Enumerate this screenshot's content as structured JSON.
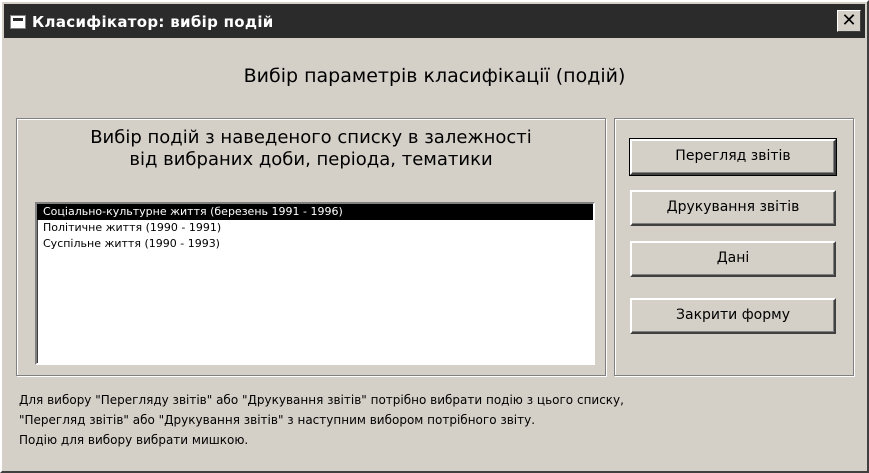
{
  "window": {
    "title": "Класифікатор: вибір подій",
    "close_glyph": "✕"
  },
  "heading": "Вибір параметрів класифікації (подій)",
  "left_panel": {
    "title_line1": "Вибір подій з наведеного списку в залежності",
    "title_line2": "від вибраних доби, періода, тематики",
    "list_items": [
      "Соціально-культурне життя (березень 1991 - 1996)",
      "Політичне життя (1990 - 1991)",
      "Суспільне життя (1990 - 1993)"
    ],
    "selected_index": 0
  },
  "buttons": {
    "view_reports": "Перегляд звітів",
    "print_reports": "Друкування звітів",
    "data": "Дані",
    "close_form": "Закрити форму"
  },
  "footer": {
    "line1": "Для вибору \"Перегляду звітів\" або \"Друкування звітів\" потрібно вибрати подію з цього списку,",
    "line2": "\"Перегляд звітів\" або \"Друкування звітів\" з наступним вибором потрібного звіту.",
    "line3": "Подію для вибору вибрати мишкою."
  }
}
